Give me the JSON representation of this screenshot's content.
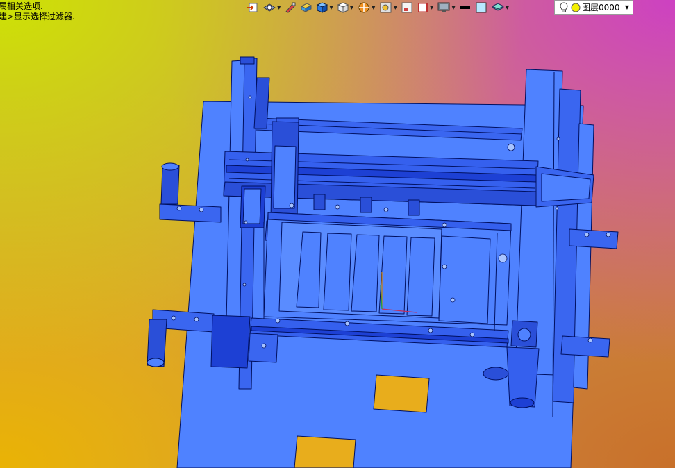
{
  "hints": {
    "line1": "属相关选项.",
    "line2": "建>显示选择过滤器."
  },
  "toolbar": {
    "buttons": [
      {
        "icon": "import-icon"
      },
      {
        "icon": "view-orient-icon",
        "dropdown": true
      },
      {
        "icon": "edit-appearance-icon"
      },
      {
        "icon": "material-icon"
      },
      {
        "icon": "cube-shaded-icon",
        "dropdown": true
      },
      {
        "icon": "cube-display-icon",
        "dropdown": true
      },
      {
        "icon": "section-view-icon",
        "dropdown": true
      },
      {
        "icon": "zoom-fit-icon",
        "dropdown": true
      },
      {
        "icon": "hide-show-icon"
      },
      {
        "icon": "layout-icon",
        "dropdown": true
      },
      {
        "icon": "monitor-icon",
        "dropdown": true
      },
      {
        "icon": "line-color-icon"
      },
      {
        "icon": "fill-color-icon"
      },
      {
        "icon": "layer-stack-icon",
        "dropdown": true
      }
    ]
  },
  "layer": {
    "label": "图层0000"
  },
  "colors": {
    "model_fill": "#4f82ff",
    "model_dark": "#1535c6",
    "model_edge": "#001060",
    "cutout": "#e8ad1c"
  }
}
